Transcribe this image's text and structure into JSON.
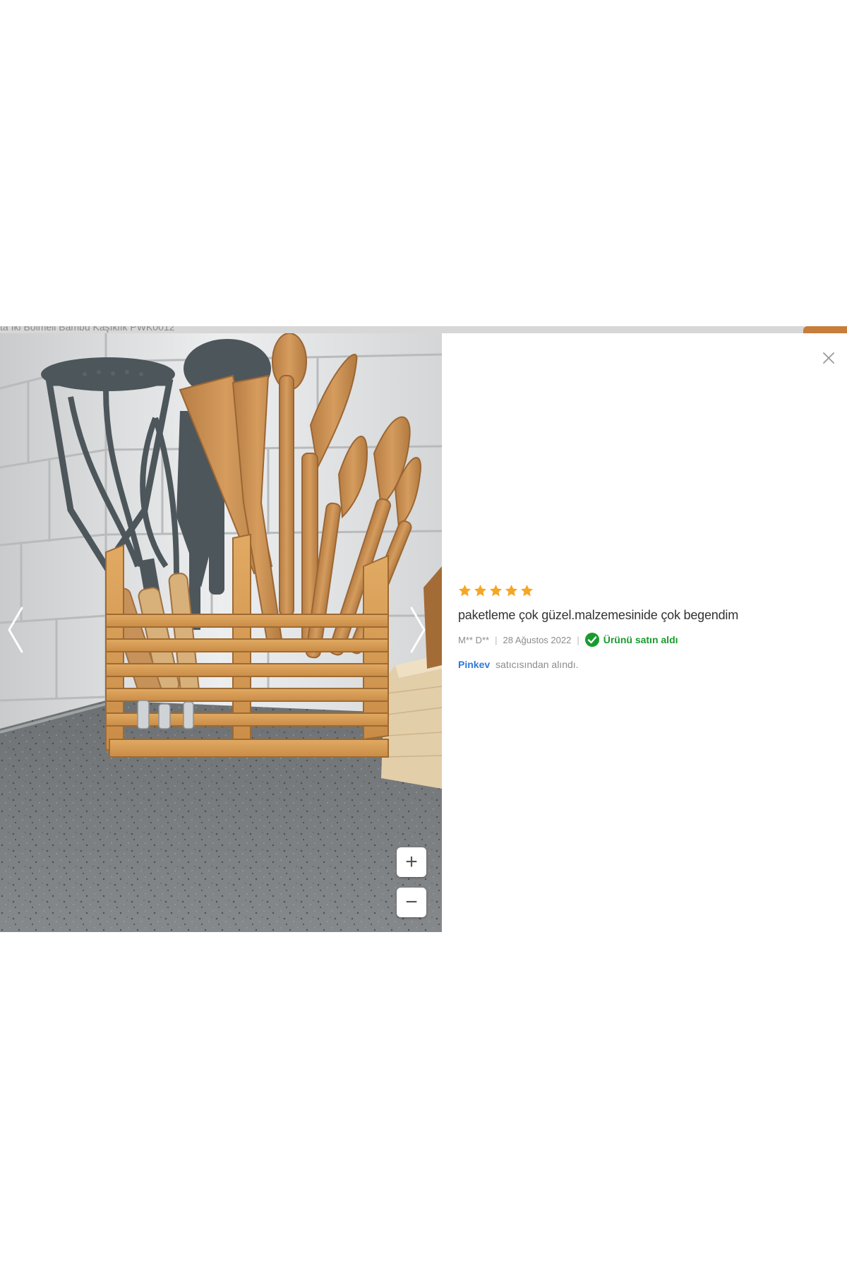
{
  "header": {
    "product_title": "ta İki Bölmeli Bambu Kaşıklık PWK0012"
  },
  "gallery": {
    "prev_icon": "chevron-left-icon",
    "next_icon": "chevron-right-icon",
    "zoom_in_label": "+",
    "zoom_out_label": "−"
  },
  "review": {
    "rating": 5,
    "rating_max": 5,
    "text": "paketleme çok güzel.malzemesinide çok begendim",
    "author": "M** D**",
    "date": "28 Ağustos 2022",
    "verified_label": "Ürünü satın aldı",
    "seller_name": "Pinkev",
    "seller_suffix": "satıcısından alındı."
  },
  "colors": {
    "star": "#f5a623",
    "verified": "#1a9b2f",
    "seller_link": "#2f7ad9",
    "accent": "#c77d3b"
  }
}
